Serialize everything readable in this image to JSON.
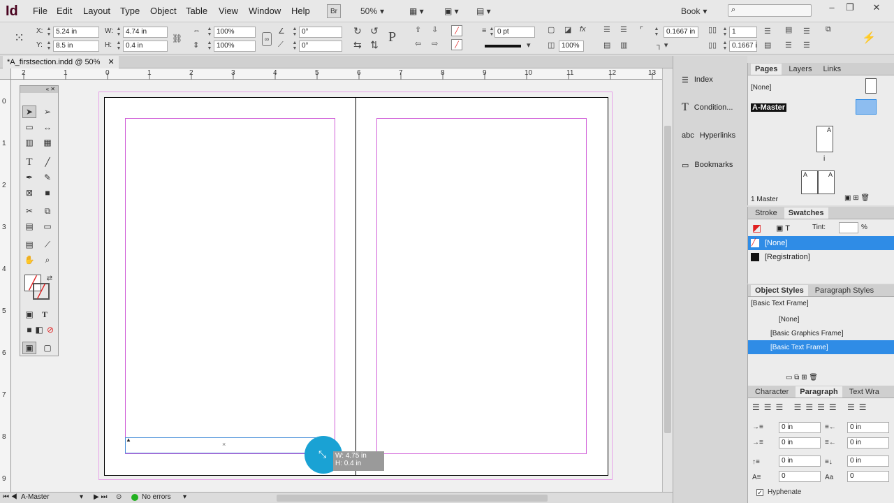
{
  "app": {
    "logo": "Id",
    "bridge": "Br",
    "zoom": "50%",
    "workspace": "Book"
  },
  "menu": [
    "File",
    "Edit",
    "Layout",
    "Type",
    "Object",
    "Table",
    "View",
    "Window",
    "Help"
  ],
  "control": {
    "x_label": "X:",
    "x": "5.24 in",
    "y_label": "Y:",
    "y": "8.5 in",
    "w_label": "W:",
    "w": "4.74 in",
    "h_label": "H:",
    "h": "0.4 in",
    "scale_x": "100%",
    "scale_y": "100%",
    "rot": "0°",
    "shear": "0°",
    "stroke_w": "0 pt",
    "opacity": "100%",
    "corner": "0.1667 in",
    "cols": "1",
    "col_gutter": "0.1667 i"
  },
  "doc_tab": "*A_firstsection.indd @ 50%",
  "ruler_h": [
    "2",
    "1",
    "0",
    "1",
    "2",
    "3",
    "4",
    "5",
    "6",
    "7",
    "8",
    "9",
    "10",
    "11",
    "12",
    "13"
  ],
  "ruler_v": [
    "0",
    "1",
    "2",
    "3",
    "4",
    "5",
    "6",
    "7",
    "8",
    "9"
  ],
  "tooltip": {
    "w": "W: 4.75 in",
    "h": "H: 0.4 in"
  },
  "dock": {
    "index": "Index",
    "conditional": "Condition...",
    "hyperlinks": "Hyperlinks",
    "bookmarks": "Bookmarks"
  },
  "pages_panel": {
    "tabs": [
      "Pages",
      "Layers",
      "Links"
    ],
    "none": "[None]",
    "master": "A-Master",
    "page_letter": "A",
    "page_num": "i",
    "footer": "1 Master"
  },
  "swatches_panel": {
    "tabs": [
      "Stroke",
      "Swatches"
    ],
    "tint_label": "Tint:",
    "tint_unit": "%",
    "rows": [
      "[None]",
      "[Registration]"
    ]
  },
  "styles_panel": {
    "tabs": [
      "Object Styles",
      "Paragraph Styles"
    ],
    "current": "[Basic Text Frame]",
    "rows": [
      "[None]",
      "[Basic Graphics Frame]",
      "[Basic Text Frame]"
    ]
  },
  "para_panel": {
    "tabs": [
      "Character",
      "Paragraph",
      "Text Wra"
    ],
    "left_indent": "0 in",
    "right_indent": "0 in",
    "first_indent": "0 in",
    "last_indent": "0 in",
    "space_before": "0 in",
    "space_after": "0 in",
    "drop_lines": "0",
    "drop_chars": "0",
    "hyphenate": "Hyphenate"
  },
  "status": {
    "page": "A-Master",
    "errors": "No errors"
  }
}
